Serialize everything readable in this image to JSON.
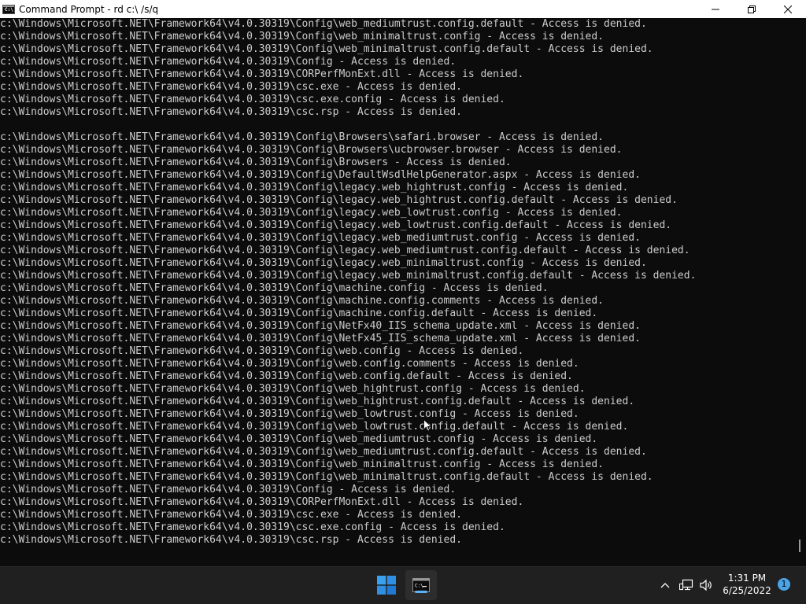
{
  "window": {
    "title": "Command Prompt - rd  c:\\ /s/q",
    "icon_label": "C:\\",
    "buttons": [
      "minimize-icon",
      "maximize-icon",
      "close-icon"
    ]
  },
  "console": {
    "lines": [
      "c:\\Windows\\Microsoft.NET\\Framework64\\v4.0.30319\\Config\\web_mediumtrust.config.default - Access is denied.",
      "c:\\Windows\\Microsoft.NET\\Framework64\\v4.0.30319\\Config\\web_minimaltrust.config - Access is denied.",
      "c:\\Windows\\Microsoft.NET\\Framework64\\v4.0.30319\\Config\\web_minimaltrust.config.default - Access is denied.",
      "c:\\Windows\\Microsoft.NET\\Framework64\\v4.0.30319\\Config - Access is denied.",
      "c:\\Windows\\Microsoft.NET\\Framework64\\v4.0.30319\\CORPerfMonExt.dll - Access is denied.",
      "c:\\Windows\\Microsoft.NET\\Framework64\\v4.0.30319\\csc.exe - Access is denied.",
      "c:\\Windows\\Microsoft.NET\\Framework64\\v4.0.30319\\csc.exe.config - Access is denied.",
      "c:\\Windows\\Microsoft.NET\\Framework64\\v4.0.30319\\csc.rsp - Access is denied.",
      "",
      "c:\\Windows\\Microsoft.NET\\Framework64\\v4.0.30319\\Config\\Browsers\\safari.browser - Access is denied.",
      "c:\\Windows\\Microsoft.NET\\Framework64\\v4.0.30319\\Config\\Browsers\\ucbrowser.browser - Access is denied.",
      "c:\\Windows\\Microsoft.NET\\Framework64\\v4.0.30319\\Config\\Browsers - Access is denied.",
      "c:\\Windows\\Microsoft.NET\\Framework64\\v4.0.30319\\Config\\DefaultWsdlHelpGenerator.aspx - Access is denied.",
      "c:\\Windows\\Microsoft.NET\\Framework64\\v4.0.30319\\Config\\legacy.web_hightrust.config - Access is denied.",
      "c:\\Windows\\Microsoft.NET\\Framework64\\v4.0.30319\\Config\\legacy.web_hightrust.config.default - Access is denied.",
      "c:\\Windows\\Microsoft.NET\\Framework64\\v4.0.30319\\Config\\legacy.web_lowtrust.config - Access is denied.",
      "c:\\Windows\\Microsoft.NET\\Framework64\\v4.0.30319\\Config\\legacy.web_lowtrust.config.default - Access is denied.",
      "c:\\Windows\\Microsoft.NET\\Framework64\\v4.0.30319\\Config\\legacy.web_mediumtrust.config - Access is denied.",
      "c:\\Windows\\Microsoft.NET\\Framework64\\v4.0.30319\\Config\\legacy.web_mediumtrust.config.default - Access is denied.",
      "c:\\Windows\\Microsoft.NET\\Framework64\\v4.0.30319\\Config\\legacy.web_minimaltrust.config - Access is denied.",
      "c:\\Windows\\Microsoft.NET\\Framework64\\v4.0.30319\\Config\\legacy.web_minimaltrust.config.default - Access is denied.",
      "c:\\Windows\\Microsoft.NET\\Framework64\\v4.0.30319\\Config\\machine.config - Access is denied.",
      "c:\\Windows\\Microsoft.NET\\Framework64\\v4.0.30319\\Config\\machine.config.comments - Access is denied.",
      "c:\\Windows\\Microsoft.NET\\Framework64\\v4.0.30319\\Config\\machine.config.default - Access is denied.",
      "c:\\Windows\\Microsoft.NET\\Framework64\\v4.0.30319\\Config\\NetFx40_IIS_schema_update.xml - Access is denied.",
      "c:\\Windows\\Microsoft.NET\\Framework64\\v4.0.30319\\Config\\NetFx45_IIS_schema_update.xml - Access is denied.",
      "c:\\Windows\\Microsoft.NET\\Framework64\\v4.0.30319\\Config\\web.config - Access is denied.",
      "c:\\Windows\\Microsoft.NET\\Framework64\\v4.0.30319\\Config\\web.config.comments - Access is denied.",
      "c:\\Windows\\Microsoft.NET\\Framework64\\v4.0.30319\\Config\\web.config.default - Access is denied.",
      "c:\\Windows\\Microsoft.NET\\Framework64\\v4.0.30319\\Config\\web_hightrust.config - Access is denied.",
      "c:\\Windows\\Microsoft.NET\\Framework64\\v4.0.30319\\Config\\web_hightrust.config.default - Access is denied.",
      "c:\\Windows\\Microsoft.NET\\Framework64\\v4.0.30319\\Config\\web_lowtrust.config - Access is denied.",
      "c:\\Windows\\Microsoft.NET\\Framework64\\v4.0.30319\\Config\\web_lowtrust.config.default - Access is denied.",
      "c:\\Windows\\Microsoft.NET\\Framework64\\v4.0.30319\\Config\\web_mediumtrust.config - Access is denied.",
      "c:\\Windows\\Microsoft.NET\\Framework64\\v4.0.30319\\Config\\web_mediumtrust.config.default - Access is denied.",
      "c:\\Windows\\Microsoft.NET\\Framework64\\v4.0.30319\\Config\\web_minimaltrust.config - Access is denied.",
      "c:\\Windows\\Microsoft.NET\\Framework64\\v4.0.30319\\Config\\web_minimaltrust.config.default - Access is denied.",
      "c:\\Windows\\Microsoft.NET\\Framework64\\v4.0.30319\\Config - Access is denied.",
      "c:\\Windows\\Microsoft.NET\\Framework64\\v4.0.30319\\CORPerfMonExt.dll - Access is denied.",
      "c:\\Windows\\Microsoft.NET\\Framework64\\v4.0.30319\\csc.exe - Access is denied.",
      "c:\\Windows\\Microsoft.NET\\Framework64\\v4.0.30319\\csc.exe.config - Access is denied.",
      "c:\\Windows\\Microsoft.NET\\Framework64\\v4.0.30319\\csc.rsp - Access is denied."
    ]
  },
  "taskbar": {
    "start_icon": "windows-logo-icon",
    "pinned": [
      {
        "name": "command-prompt-icon",
        "active": true
      }
    ],
    "tray_icons": [
      "chevron-up-icon",
      "network-icon",
      "volume-icon"
    ],
    "time": "1:31 PM",
    "date": "6/25/2022",
    "notification_count": "1"
  },
  "colors": {
    "console_bg": "#0c0c0c",
    "console_text": "#cccccc",
    "taskbar_bg": "#202020",
    "accent": "#4ca4e8"
  }
}
